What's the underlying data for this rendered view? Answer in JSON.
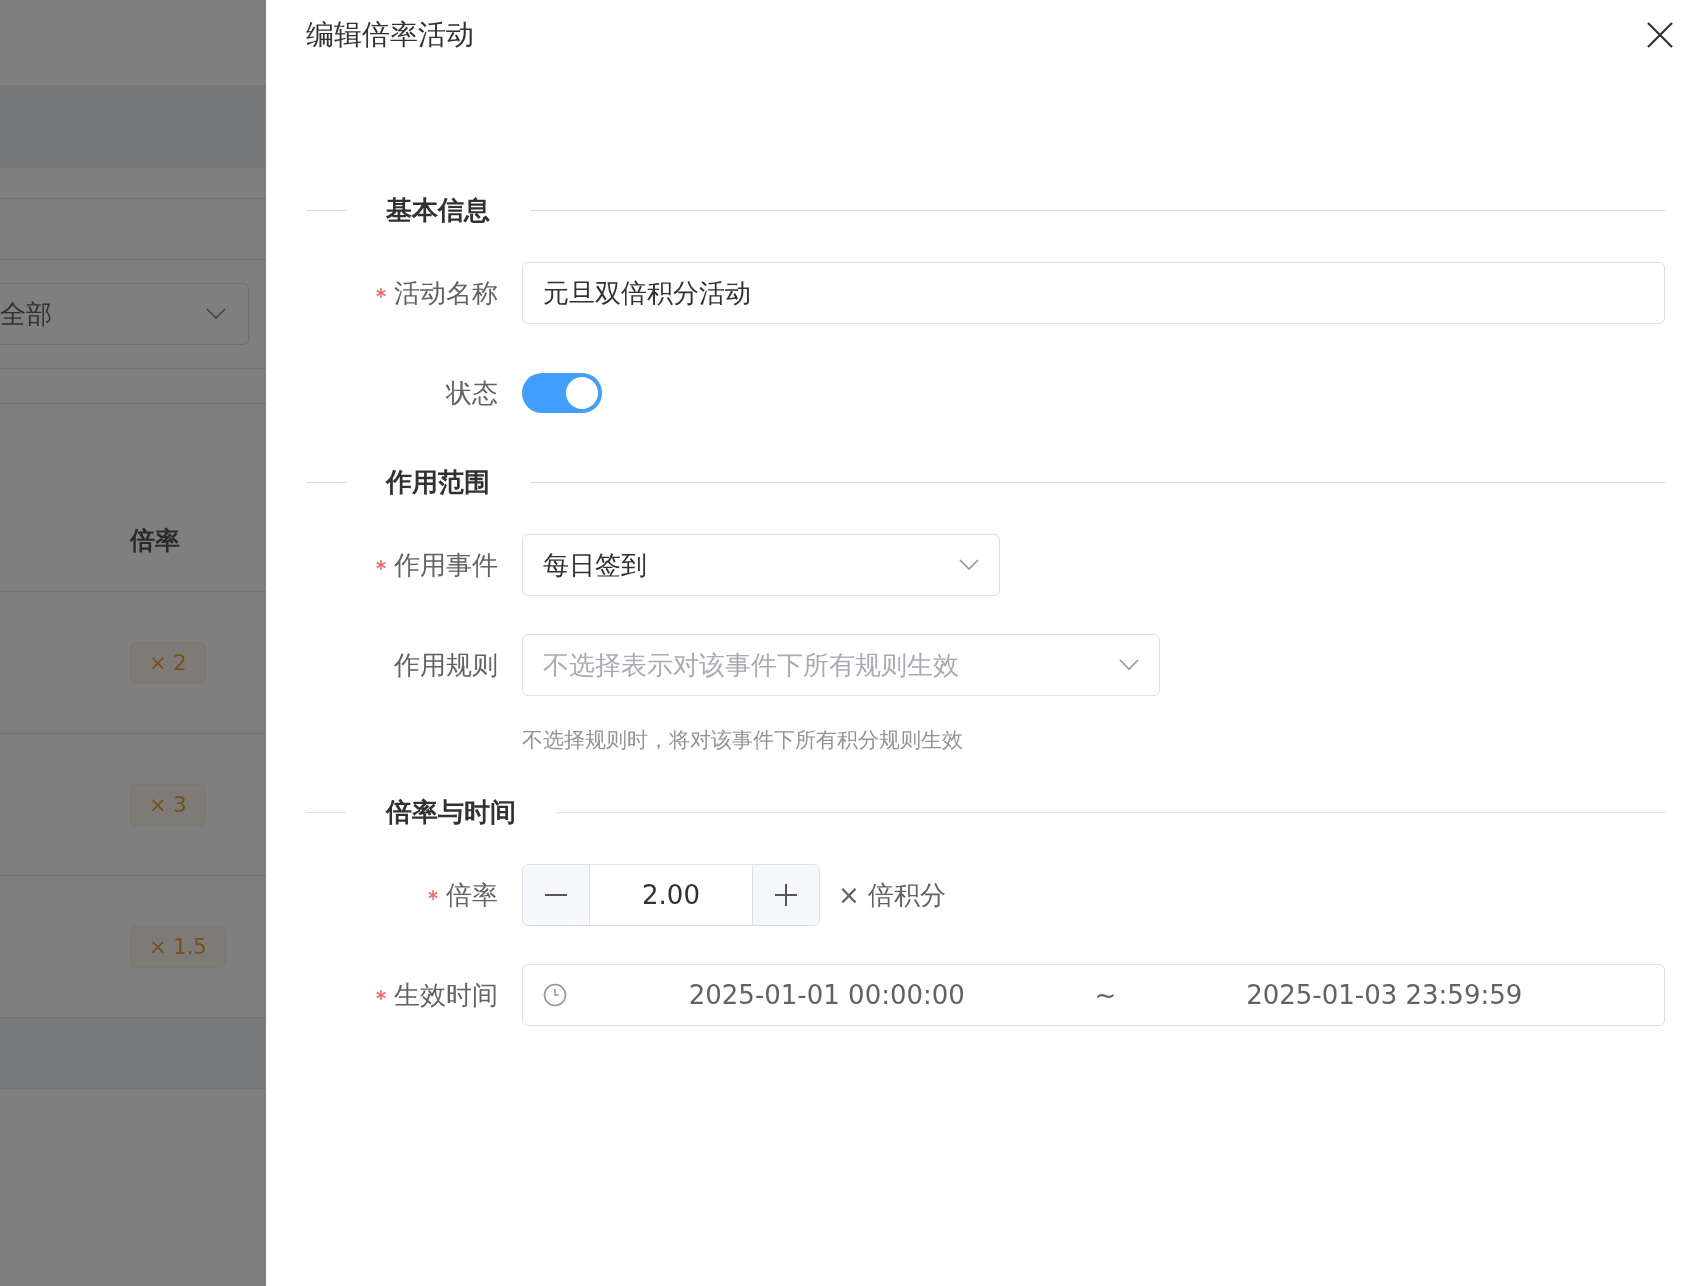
{
  "background": {
    "filter_select": {
      "value": "全部"
    },
    "table": {
      "column": "倍率",
      "rows": [
        {
          "multiplier": "× 2"
        },
        {
          "multiplier": "× 3"
        },
        {
          "multiplier": "× 1.5"
        }
      ]
    }
  },
  "drawer": {
    "title": "编辑倍率活动",
    "sections": [
      {
        "title": "基本信息",
        "fields": [
          {
            "kind": "text",
            "label": "活动名称",
            "required": true,
            "value": "元旦双倍积分活动"
          },
          {
            "kind": "switch",
            "label": "状态",
            "required": false,
            "on": true
          }
        ]
      },
      {
        "title": "作用范围",
        "fields": [
          {
            "kind": "select",
            "label": "作用事件",
            "required": true,
            "value": "每日签到"
          },
          {
            "kind": "select",
            "label": "作用规则",
            "required": false,
            "placeholder": "不选择表示对该事件下所有规则生效",
            "help": "不选择规则时，将对该事件下所有积分规则生效"
          }
        ]
      },
      {
        "title": "倍率与时间",
        "fields": [
          {
            "kind": "number",
            "label": "倍率",
            "required": true,
            "value": "2.00",
            "suffix": "× 倍积分"
          },
          {
            "kind": "daterange",
            "label": "生效时间",
            "required": true,
            "start": "2025-01-01 00:00:00",
            "separator": "~",
            "end": "2025-01-03 23:59:59"
          }
        ]
      }
    ]
  }
}
